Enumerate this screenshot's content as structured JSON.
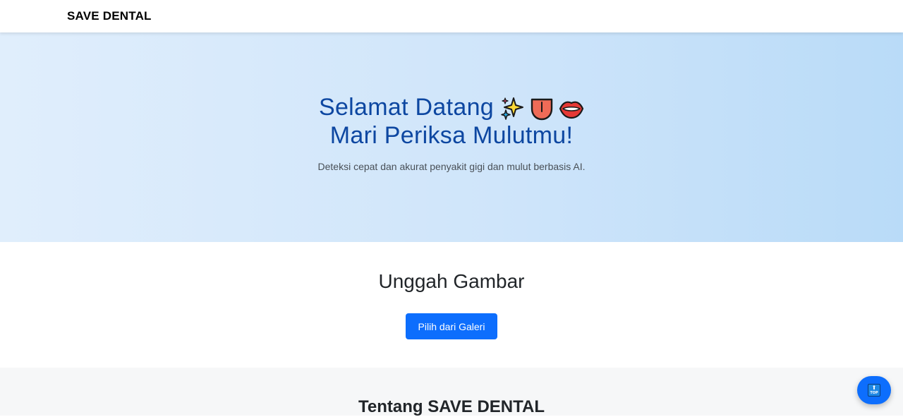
{
  "navbar": {
    "brand": "SAVE DENTAL"
  },
  "hero": {
    "title_line1": "Selamat Datang",
    "title_line2": "Mari Periksa Mulutmu!",
    "emojis": [
      "sparkles-icon",
      "tongue-icon",
      "lips-icon"
    ],
    "subtitle": "Deteksi cepat dan akurat penyakit gigi dan mulut berbasis AI.",
    "title_color": "#0d47a1"
  },
  "upload": {
    "title": "Unggah Gambar",
    "button_label": "Pilih dari Galeri",
    "button_color": "#0d6efd"
  },
  "about": {
    "title": "Tentang SAVE DENTAL"
  },
  "scroll_top": {
    "label": "TOP",
    "icon": "arrow-up-icon"
  }
}
